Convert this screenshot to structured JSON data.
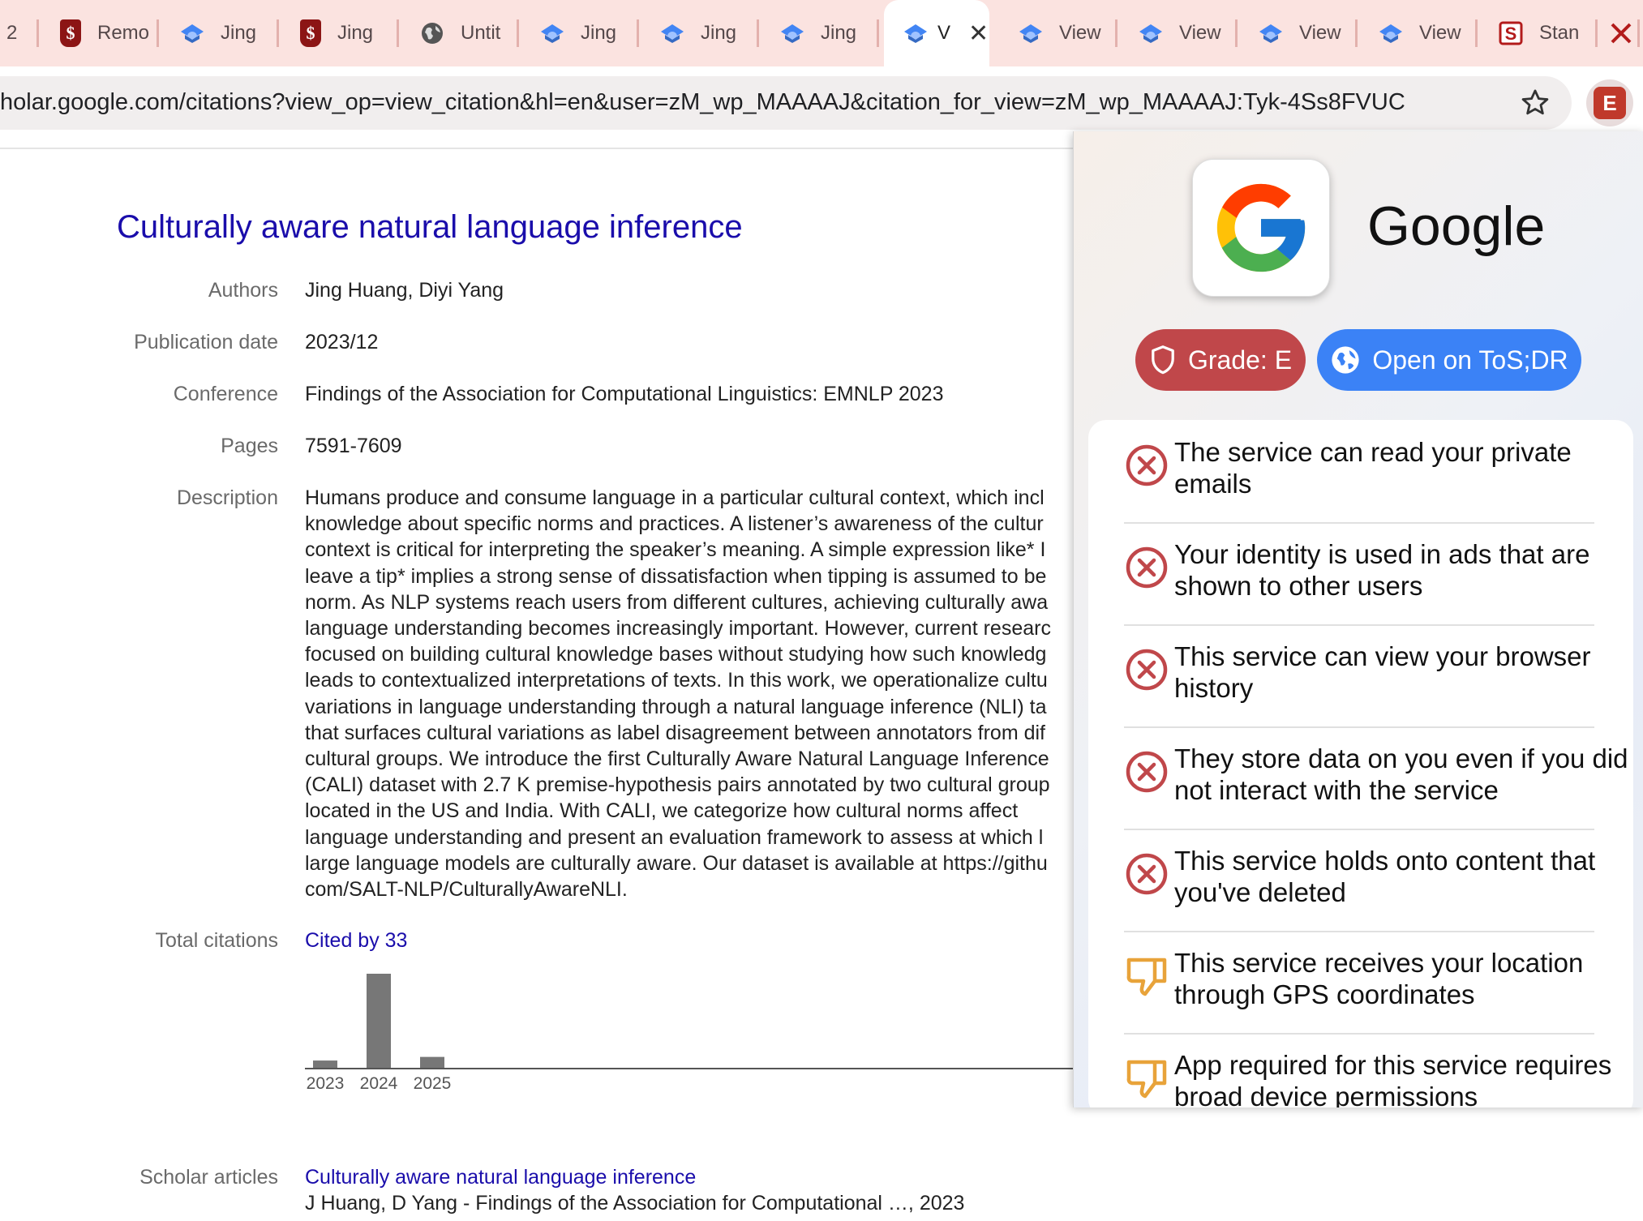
{
  "browser": {
    "tabs": [
      {
        "title": "2",
        "icon": "default-icon",
        "active": false
      },
      {
        "title": "Remo",
        "icon": "stanford-icon",
        "active": false
      },
      {
        "title": "Jing",
        "icon": "scholar-icon",
        "active": false
      },
      {
        "title": "Jing",
        "icon": "stanford-icon",
        "active": false
      },
      {
        "title": "Untit",
        "icon": "globe-icon",
        "active": false
      },
      {
        "title": "Jing",
        "icon": "scholar-icon",
        "active": false
      },
      {
        "title": "Jing",
        "icon": "scholar-icon",
        "active": false
      },
      {
        "title": "Jing",
        "icon": "scholar-icon",
        "active": false
      },
      {
        "title": "V",
        "icon": "scholar-icon",
        "active": true
      },
      {
        "title": "View",
        "icon": "scholar-icon",
        "active": false
      },
      {
        "title": "View",
        "icon": "scholar-icon",
        "active": false
      },
      {
        "title": "View",
        "icon": "scholar-icon",
        "active": false
      },
      {
        "title": "View",
        "icon": "scholar-icon",
        "active": false
      },
      {
        "title": "Stan",
        "icon": "stanford-s-icon",
        "active": false
      }
    ],
    "tab_close": "✕",
    "url": "holar.google.com/citations?view_op=view_citation&hl=en&user=zM_wp_MAAAAJ&citation_for_view=zM_wp_MAAAAJ:Tyk-4Ss8FVUC",
    "extension_badge": "E",
    "extension_color": "#c0392b"
  },
  "paper": {
    "title": "Culturally aware natural language inference",
    "fields": {
      "authors_label": "Authors",
      "authors": "Jing Huang, Diyi Yang",
      "date_label": "Publication date",
      "date": "2023/12",
      "conference_label": "Conference",
      "conference": "Findings of the Association for Computational Linguistics: EMNLP 2023",
      "pages_label": "Pages",
      "pages": "7591-7609",
      "description_label": "Description",
      "citations_label": "Total citations",
      "cited_by": "Cited by 33",
      "scholar_label": "Scholar articles",
      "scholar_title": "Culturally aware natural language inference",
      "scholar_authors": "J Huang, D Yang - Findings of the Association for Computational …, 2023"
    },
    "description_lines": [
      "Humans produce and consume language in a particular cultural context, which incl",
      "knowledge about specific norms and practices. A listener’s awareness of the cultur",
      "context is critical for interpreting the speaker’s meaning. A simple expression like* I",
      "leave a tip* implies a strong sense of dissatisfaction when tipping is assumed to be",
      "norm. As NLP systems reach users from different cultures, achieving culturally awa",
      "language understanding becomes increasingly important. However, current researc",
      "focused on building cultural knowledge bases without studying how such knowledg",
      "leads to contextualized interpretations of texts. In this work, we operationalize cultu",
      "variations in language understanding through a natural language inference (NLI) ta",
      "that surfaces cultural variations as label disagreement between annotators from dif",
      "cultural groups. We introduce the first Culturally Aware Natural Language Inference",
      "(CALI) dataset with 2.7 K premise-hypothesis pairs annotated by two cultural group",
      "located in the US and India. With CALI, we categorize how cultural norms affect",
      "language understanding and present an evaluation framework to assess at which l",
      "large language models are culturally aware. Our dataset is available at https://githu",
      "com/SALT-NLP/CulturallyAwareNLI."
    ]
  },
  "chart_data": {
    "type": "bar",
    "categories": [
      "2023",
      "2024",
      "2025"
    ],
    "values": [
      1,
      13,
      1.5
    ],
    "ylim": [
      0,
      13
    ],
    "color": "#777777",
    "title": "",
    "xlabel": "",
    "ylabel": ""
  },
  "popup": {
    "service": "Google",
    "grade_button": "Grade: E",
    "grade_color": "#c0474a",
    "open_button": "Open on ToS;DR",
    "open_color": "#3b82f6",
    "points": [
      {
        "text": "The service can read your private emails",
        "type": "blocker",
        "icon": "x-circle-icon"
      },
      {
        "text": "Your identity is used in ads that are shown to other users",
        "type": "blocker",
        "icon": "x-circle-icon"
      },
      {
        "text": "This service can view your browser history",
        "type": "blocker",
        "icon": "x-circle-icon"
      },
      {
        "text": "They store data on you even if you did not interact with the service",
        "type": "blocker",
        "icon": "x-circle-icon"
      },
      {
        "text": "This service holds onto content that you've deleted",
        "type": "blocker",
        "icon": "x-circle-icon"
      },
      {
        "text": "This service receives your location through GPS coordinates",
        "type": "bad",
        "icon": "thumbs-down-icon"
      },
      {
        "text": "App required for this service requires broad device permissions",
        "type": "bad",
        "icon": "thumbs-down-icon"
      }
    ],
    "blocker_color": "#c0474a",
    "bad_color": "#e8a33a"
  }
}
